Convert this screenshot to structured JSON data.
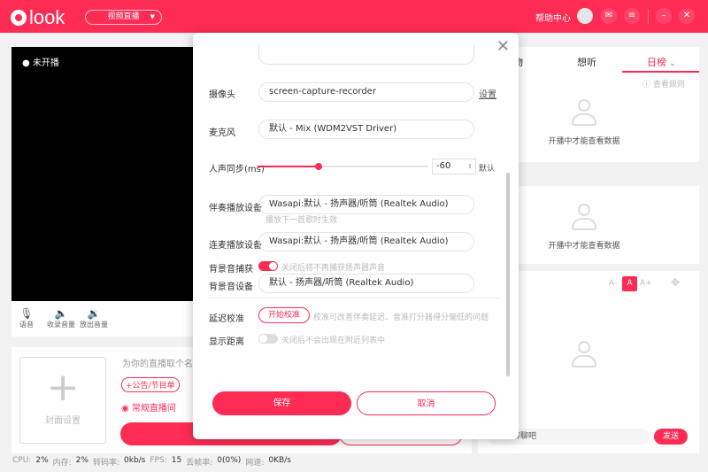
{
  "header": {
    "logo": "look",
    "mode": "视频直播",
    "help": "帮助中心",
    "icons": [
      "avatar",
      "mail-icon",
      "menu-icon",
      "minimize-icon",
      "close-icon"
    ]
  },
  "video": {
    "status": "未开播"
  },
  "controls": [
    {
      "icon": "microphone-icon",
      "label": "语音"
    },
    {
      "icon": "record-volume-icon",
      "label": "收录音量"
    },
    {
      "icon": "speaker-volume-icon",
      "label": "放出音量"
    }
  ],
  "bottom": {
    "cover_label": "封面设置",
    "title_placeholder": "为你的直播取个名",
    "notice_button": "+公告/节目单",
    "room_type": "常规直播间"
  },
  "statusbar": [
    {
      "label": "CPU:",
      "value": "2%"
    },
    {
      "label": "内存:",
      "value": "2%"
    },
    {
      "label": "转码率:",
      "value": "0kb/s"
    },
    {
      "label": "FPS:",
      "value": "15"
    },
    {
      "label": "丢帧率:",
      "value": "0(0%)"
    },
    {
      "label": "网速:",
      "value": "0KB/s"
    }
  ],
  "right": {
    "tabs": [
      "物",
      "想听",
      "日榜"
    ],
    "active_tab": "日榜",
    "rules": "查看规则",
    "empty_text": "开播中才能查看数据",
    "font_small": "A-",
    "font_normal": "A",
    "font_large": "A+",
    "chat_placeholder": "来聊聊吧",
    "send": "发送"
  },
  "dialog": {
    "camera_label": "摄像头",
    "camera_value": "screen-capture-recorder",
    "camera_settings": "设置",
    "mic_label": "麦克风",
    "mic_value": "默认 - Mix (WDM2VST Driver)",
    "sync_label": "人声同步(ms)",
    "sync_value": "-60",
    "sync_default": "默认",
    "sync_fraction": 0.36,
    "accomp_label": "伴奏播放设备",
    "accomp_value": "Wasapi:默认 - 扬声器/听筒 (Realtek Audio)",
    "accomp_hint": "播放下一首歌时生效",
    "link_label": "连麦播放设备",
    "link_value": "Wasapi:默认 - 扬声器/听筒 (Realtek Audio)",
    "bg_capture_label": "背景音捕获",
    "bg_capture_on": true,
    "bg_capture_hint": "关闭后将不再捕获扬声器声音",
    "bg_device_label": "背景音设备",
    "bg_device_value": "默认 - 扬声器/听筒 (Realtek Audio)",
    "calib_label": "延迟校准",
    "calib_button": "开始校准",
    "calib_hint": "校准可改善伴奏延迟、音准打分器得分偏低的问题",
    "distance_label": "显示距离",
    "distance_on": false,
    "distance_hint": "关闭后不会出现在附近列表中",
    "save": "保存",
    "cancel": "取消"
  },
  "colors": {
    "brand": "#fe2c55"
  }
}
